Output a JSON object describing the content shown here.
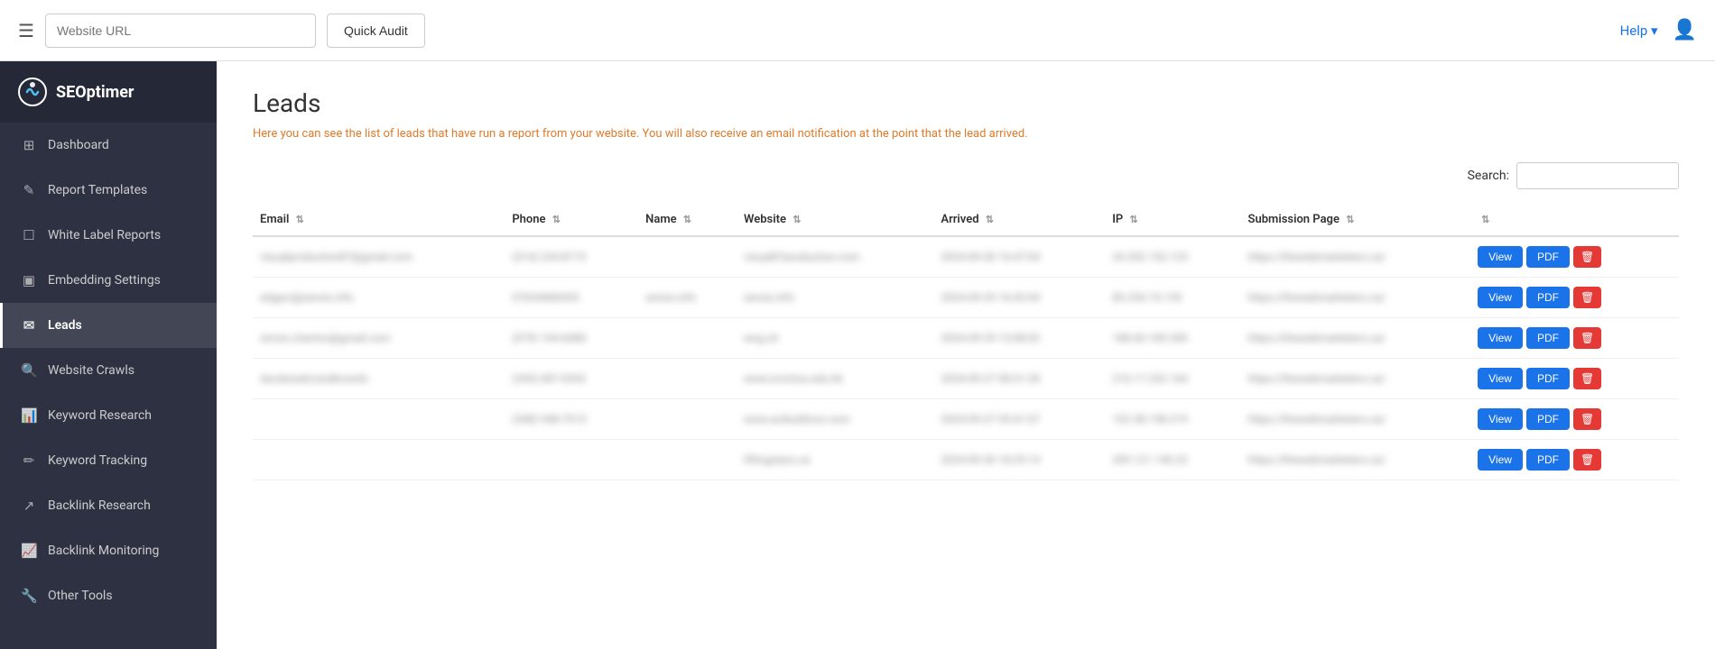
{
  "topbar": {
    "url_placeholder": "Website URL",
    "quick_audit_label": "Quick Audit",
    "help_label": "Help ▾"
  },
  "sidebar": {
    "logo_text": "SEOptimer",
    "items": [
      {
        "id": "dashboard",
        "label": "Dashboard",
        "icon": "⊞"
      },
      {
        "id": "report-templates",
        "label": "Report Templates",
        "icon": "✎"
      },
      {
        "id": "white-label-reports",
        "label": "White Label Reports",
        "icon": "☐"
      },
      {
        "id": "embedding-settings",
        "label": "Embedding Settings",
        "icon": "▣"
      },
      {
        "id": "leads",
        "label": "Leads",
        "icon": "✉",
        "active": true
      },
      {
        "id": "website-crawls",
        "label": "Website Crawls",
        "icon": "🔍"
      },
      {
        "id": "keyword-research",
        "label": "Keyword Research",
        "icon": "📊"
      },
      {
        "id": "keyword-tracking",
        "label": "Keyword Tracking",
        "icon": "✏"
      },
      {
        "id": "backlink-research",
        "label": "Backlink Research",
        "icon": "↗"
      },
      {
        "id": "backlink-monitoring",
        "label": "Backlink Monitoring",
        "icon": "📈"
      },
      {
        "id": "other-tools",
        "label": "Other Tools",
        "icon": "🔧"
      }
    ]
  },
  "main": {
    "page_title": "Leads",
    "page_description": "Here you can see the list of leads that have run a report from your website. You will also receive an email notification at the point that the lead arrived.",
    "search_label": "Search:",
    "search_placeholder": "",
    "table": {
      "columns": [
        {
          "id": "email",
          "label": "Email"
        },
        {
          "id": "phone",
          "label": "Phone"
        },
        {
          "id": "name",
          "label": "Name"
        },
        {
          "id": "website",
          "label": "Website"
        },
        {
          "id": "arrived",
          "label": "Arrived"
        },
        {
          "id": "ip",
          "label": "IP"
        },
        {
          "id": "submission_page",
          "label": "Submission Page"
        },
        {
          "id": "actions",
          "label": ""
        }
      ],
      "rows": [
        {
          "email": "visualproduction87@gmail.com",
          "phone": "(514) 234-8173",
          "name": "",
          "website": "visual87production.com",
          "arrived": "2024-09-30 16:47:04",
          "ip": "24.202.152.123",
          "submission_page": "https://thewebmarketers.ca/",
          "blurred": true
        },
        {
          "email": "edgars@serois.info",
          "phone": "07634680435",
          "name": "serois.info",
          "website": "serois.info",
          "arrived": "2024-09-29 16:42:04",
          "ip": "85.254.74.135",
          "submission_page": "https://thewebmarketers.ca/",
          "blurred": true
        },
        {
          "email": "simon.charton@gmail.com",
          "phone": "(579) 104-6080",
          "name": "",
          "website": "wng.ch",
          "arrived": "2024-09-29 13:08:02",
          "ip": "188.60.189.200",
          "submission_page": "https://thewebmarketers.ca/",
          "blurred": true
        },
        {
          "email": "dscdewebrowdbrowdv",
          "phone": "(343) 687-6942",
          "name": "",
          "website": "www.invictus.edu.hk",
          "arrived": "2024-09-27 08:31:28",
          "ip": "210.17.252.164",
          "submission_page": "https://thewebmarketers.ca/",
          "blurred": true
        },
        {
          "email": "",
          "phone": "(548) 948-7013",
          "name": "",
          "website": "www.acibuildcon.com",
          "arrived": "2024-09-27 05:41:07",
          "ip": "152.58.198.219",
          "submission_page": "https://thewebmarketers.ca/",
          "blurred": true
        },
        {
          "email": "",
          "phone": "",
          "name": "",
          "website": "liftingstars.ca",
          "arrived": "2024-09-26 18:29:14",
          "ip": "209.121.140.22",
          "submission_page": "https://thewebmarketers.ca/",
          "blurred": true
        }
      ],
      "btn_view": "View",
      "btn_pdf": "PDF"
    }
  }
}
